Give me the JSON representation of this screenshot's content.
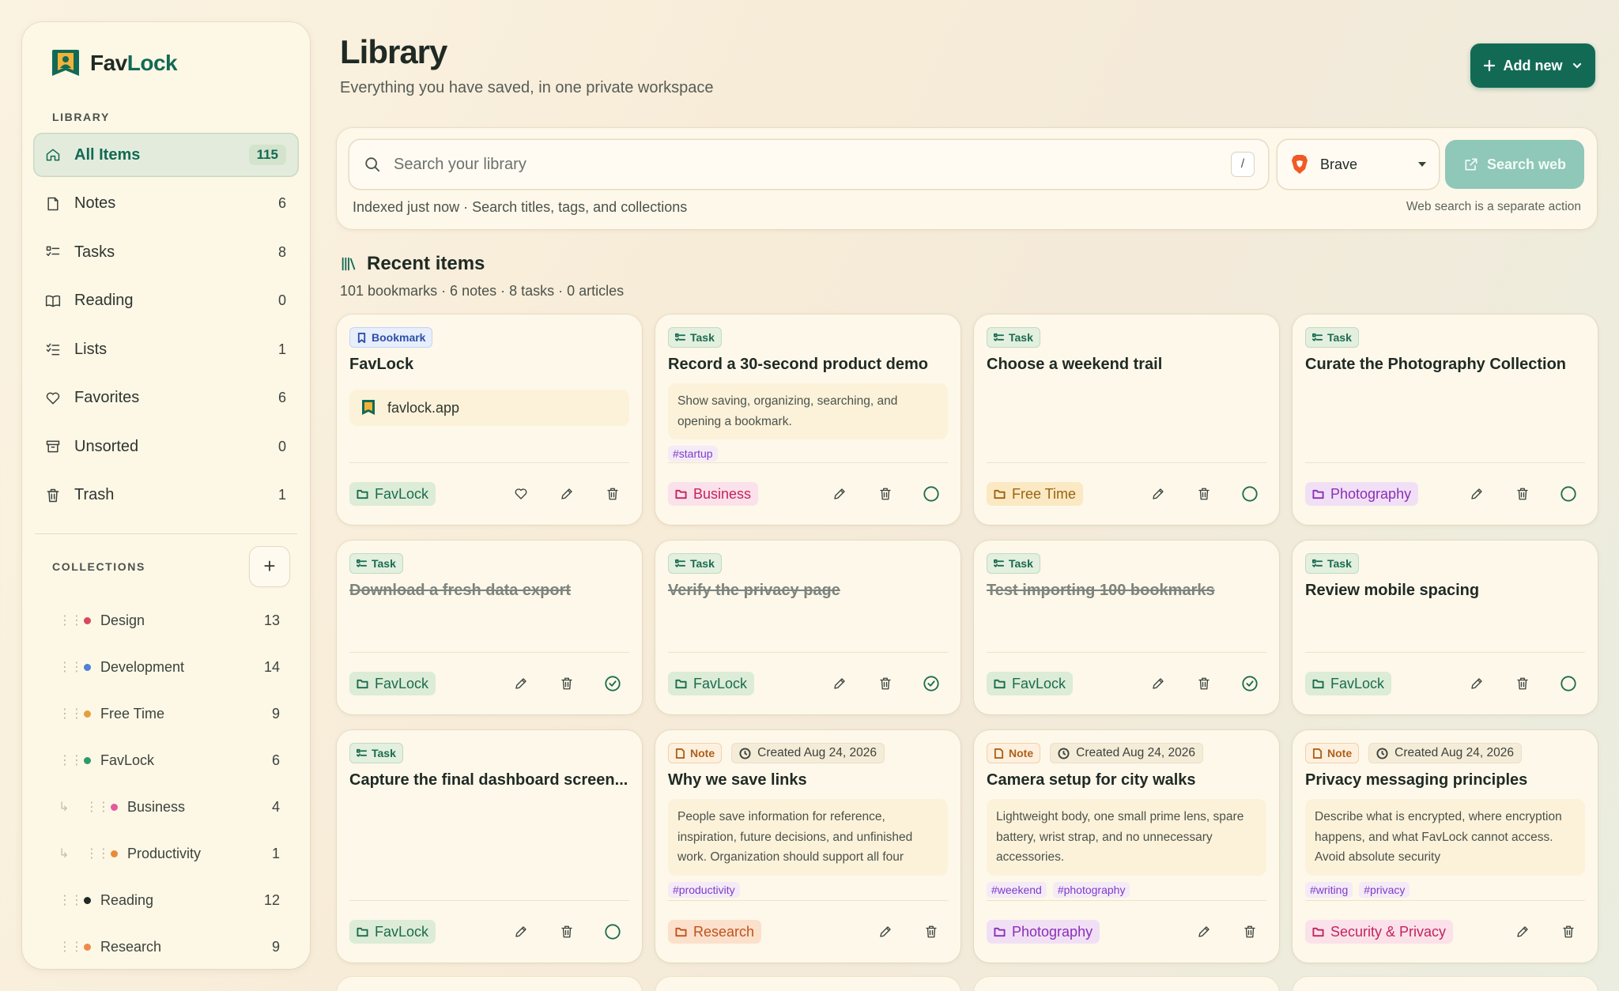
{
  "brand": {
    "name_a": "Fav",
    "name_b": "Lock"
  },
  "sidebar": {
    "library_label": "LIBRARY",
    "items": [
      {
        "label": "All Items",
        "count": "115"
      },
      {
        "label": "Notes",
        "count": "6"
      },
      {
        "label": "Tasks",
        "count": "8"
      },
      {
        "label": "Reading",
        "count": "0"
      },
      {
        "label": "Lists",
        "count": "1"
      },
      {
        "label": "Favorites",
        "count": "6"
      },
      {
        "label": "Unsorted",
        "count": "0"
      },
      {
        "label": "Trash",
        "count": "1"
      }
    ],
    "collections_label": "COLLECTIONS",
    "add_symbol": "+",
    "collections": [
      {
        "label": "Design",
        "count": "13",
        "color": "#d9485f"
      },
      {
        "label": "Development",
        "count": "14",
        "color": "#4f7fd6"
      },
      {
        "label": "Free Time",
        "count": "9",
        "color": "#e4a03a"
      },
      {
        "label": "FavLock",
        "count": "6",
        "color": "#2f9a6c"
      },
      {
        "label": "Business",
        "count": "4",
        "color": "#e45a9c"
      },
      {
        "label": "Productivity",
        "count": "1",
        "color": "#e98a3a"
      },
      {
        "label": "Reading",
        "count": "12",
        "color": "#1f2a24"
      },
      {
        "label": "Research",
        "count": "9",
        "color": "#ec8c4a"
      }
    ]
  },
  "header": {
    "title": "Library",
    "subtitle": "Everything you have saved, in one private workspace",
    "add_label": "Add new"
  },
  "search": {
    "placeholder": "Search your library",
    "shortcut": "/",
    "engine": "Brave",
    "web_label": "Search web",
    "hint": "Indexed just now · Search titles, tags, and collections",
    "note": "Web search is a separate action"
  },
  "recent": {
    "title": "Recent items",
    "summary": "101 bookmarks · 6 notes · 8 tasks · 0 articles"
  },
  "cards": [
    {
      "type": "Bookmark",
      "title": "FavLock",
      "url": "favlock.app",
      "collection": "FavLock"
    },
    {
      "type": "Task",
      "title": "Record a 30-second product demo",
      "desc": "Show saving, organizing, searching, and opening a bookmark.",
      "tags": [
        "#startup"
      ],
      "collection": "Business"
    },
    {
      "type": "Task",
      "title": "Choose a weekend trail",
      "collection": "Free Time"
    },
    {
      "type": "Task",
      "title": "Curate the Photography Collection",
      "collection": "Photography"
    },
    {
      "type": "Task",
      "title": "Download a fresh data export",
      "collection": "FavLock"
    },
    {
      "type": "Task",
      "title": "Verify the privacy page",
      "collection": "FavLock"
    },
    {
      "type": "Task",
      "title": "Test importing 100 bookmarks",
      "collection": "FavLock"
    },
    {
      "type": "Task",
      "title": "Review mobile spacing",
      "collection": "FavLock"
    },
    {
      "type": "Task",
      "title": "Capture the final dashboard screen...",
      "collection": "FavLock"
    },
    {
      "type": "Note",
      "created": "Created Aug 24, 2026",
      "title": "Why we save links",
      "desc": "People save information for reference, inspiration, future decisions, and unfinished work. Organization should support all four",
      "tags": [
        "#productivity"
      ],
      "collection": "Research"
    },
    {
      "type": "Note",
      "created": "Created Aug 24, 2026",
      "title": "Camera setup for city walks",
      "desc": "Lightweight body, one small prime lens, spare battery, wrist strap, and no unnecessary accessories.",
      "tags": [
        "#weekend",
        "#photography"
      ],
      "collection": "Photography"
    },
    {
      "type": "Note",
      "created": "Created Aug 24, 2026",
      "title": "Privacy messaging principles",
      "desc": "Describe what is encrypted, where encryption happens, and what FavLock cannot access. Avoid absolute security",
      "tags": [
        "#writing",
        "#privacy"
      ],
      "collection": "Security & Privacy"
    }
  ]
}
